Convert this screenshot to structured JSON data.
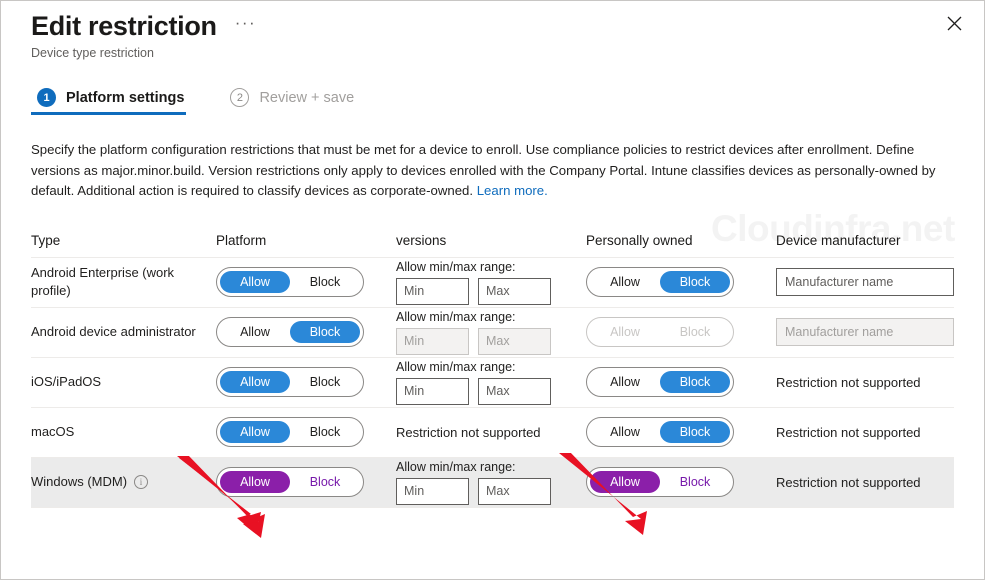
{
  "header": {
    "title": "Edit restriction",
    "subtitle": "Device type restriction",
    "more_label": "···",
    "close_label": "Close"
  },
  "watermark": "Cloudinfra.net",
  "tabs": [
    {
      "number": "1",
      "label": "Platform settings",
      "state": "active"
    },
    {
      "number": "2",
      "label": "Review + save",
      "state": "inactive"
    }
  ],
  "description": {
    "text": "Specify the platform configuration restrictions that must be met for a device to enroll. Use compliance policies to restrict devices after enrollment. Define versions as major.minor.build. Version restrictions only apply to devices enrolled with the Company Portal. Intune classifies devices as personally-owned by default. Additional action is required to classify devices as corporate-owned. ",
    "link": "Learn more."
  },
  "table": {
    "headers": {
      "type": "Type",
      "platform": "Platform",
      "versions": "versions",
      "personally_owned": "Personally owned",
      "device_manufacturer": "Device manufacturer"
    },
    "labels": {
      "allow": "Allow",
      "block": "Block",
      "range_label": "Allow min/max range:",
      "min_placeholder": "Min",
      "max_placeholder": "Max",
      "manufacturer_placeholder": "Manufacturer name",
      "not_supported": "Restriction not supported"
    },
    "rows": [
      {
        "type": "Android Enterprise (work profile)",
        "platform_selected": "Allow",
        "platform_disabled": false,
        "platform_accent": "blue",
        "versions_kind": "range",
        "versions_disabled": false,
        "min_value": "",
        "max_value": "",
        "owned_selected": "Block",
        "owned_disabled": false,
        "owned_accent": "blue",
        "manufacturer_kind": "input",
        "manufacturer_disabled": false,
        "manufacturer_value": "",
        "highlight": false,
        "info_icon": false
      },
      {
        "type": "Android device administrator",
        "platform_selected": "Block",
        "platform_disabled": false,
        "platform_accent": "blue",
        "versions_kind": "range",
        "versions_disabled": true,
        "min_value": "",
        "max_value": "",
        "owned_selected": "none",
        "owned_disabled": true,
        "owned_accent": "blue",
        "manufacturer_kind": "input",
        "manufacturer_disabled": true,
        "manufacturer_value": "",
        "highlight": false,
        "info_icon": false
      },
      {
        "type": "iOS/iPadOS",
        "platform_selected": "Allow",
        "platform_disabled": false,
        "platform_accent": "blue",
        "versions_kind": "range",
        "versions_disabled": false,
        "min_value": "",
        "max_value": "",
        "owned_selected": "Block",
        "owned_disabled": false,
        "owned_accent": "blue",
        "manufacturer_kind": "text",
        "manufacturer_disabled": false,
        "manufacturer_value": "Restriction not supported",
        "highlight": false,
        "info_icon": false
      },
      {
        "type": "macOS",
        "platform_selected": "Allow",
        "platform_disabled": false,
        "platform_accent": "blue",
        "versions_kind": "text",
        "versions_disabled": false,
        "versions_text": "Restriction not supported",
        "min_value": "",
        "max_value": "",
        "owned_selected": "Block",
        "owned_disabled": false,
        "owned_accent": "blue",
        "manufacturer_kind": "text",
        "manufacturer_disabled": false,
        "manufacturer_value": "Restriction not supported",
        "highlight": false,
        "info_icon": false
      },
      {
        "type": "Windows (MDM)",
        "platform_selected": "Allow",
        "platform_disabled": false,
        "platform_accent": "purple",
        "versions_kind": "range",
        "versions_disabled": false,
        "min_value": "",
        "max_value": "",
        "owned_selected": "Allow",
        "owned_disabled": false,
        "owned_accent": "purple",
        "manufacturer_kind": "text",
        "manufacturer_disabled": false,
        "manufacturer_value": "Restriction not supported",
        "highlight": true,
        "info_icon": true
      }
    ]
  },
  "annotations": {
    "arrow_color": "#e81123",
    "arrow_1_target": "windows-platform-allow-toggle",
    "arrow_2_target": "windows-personally-owned-allow-toggle"
  }
}
